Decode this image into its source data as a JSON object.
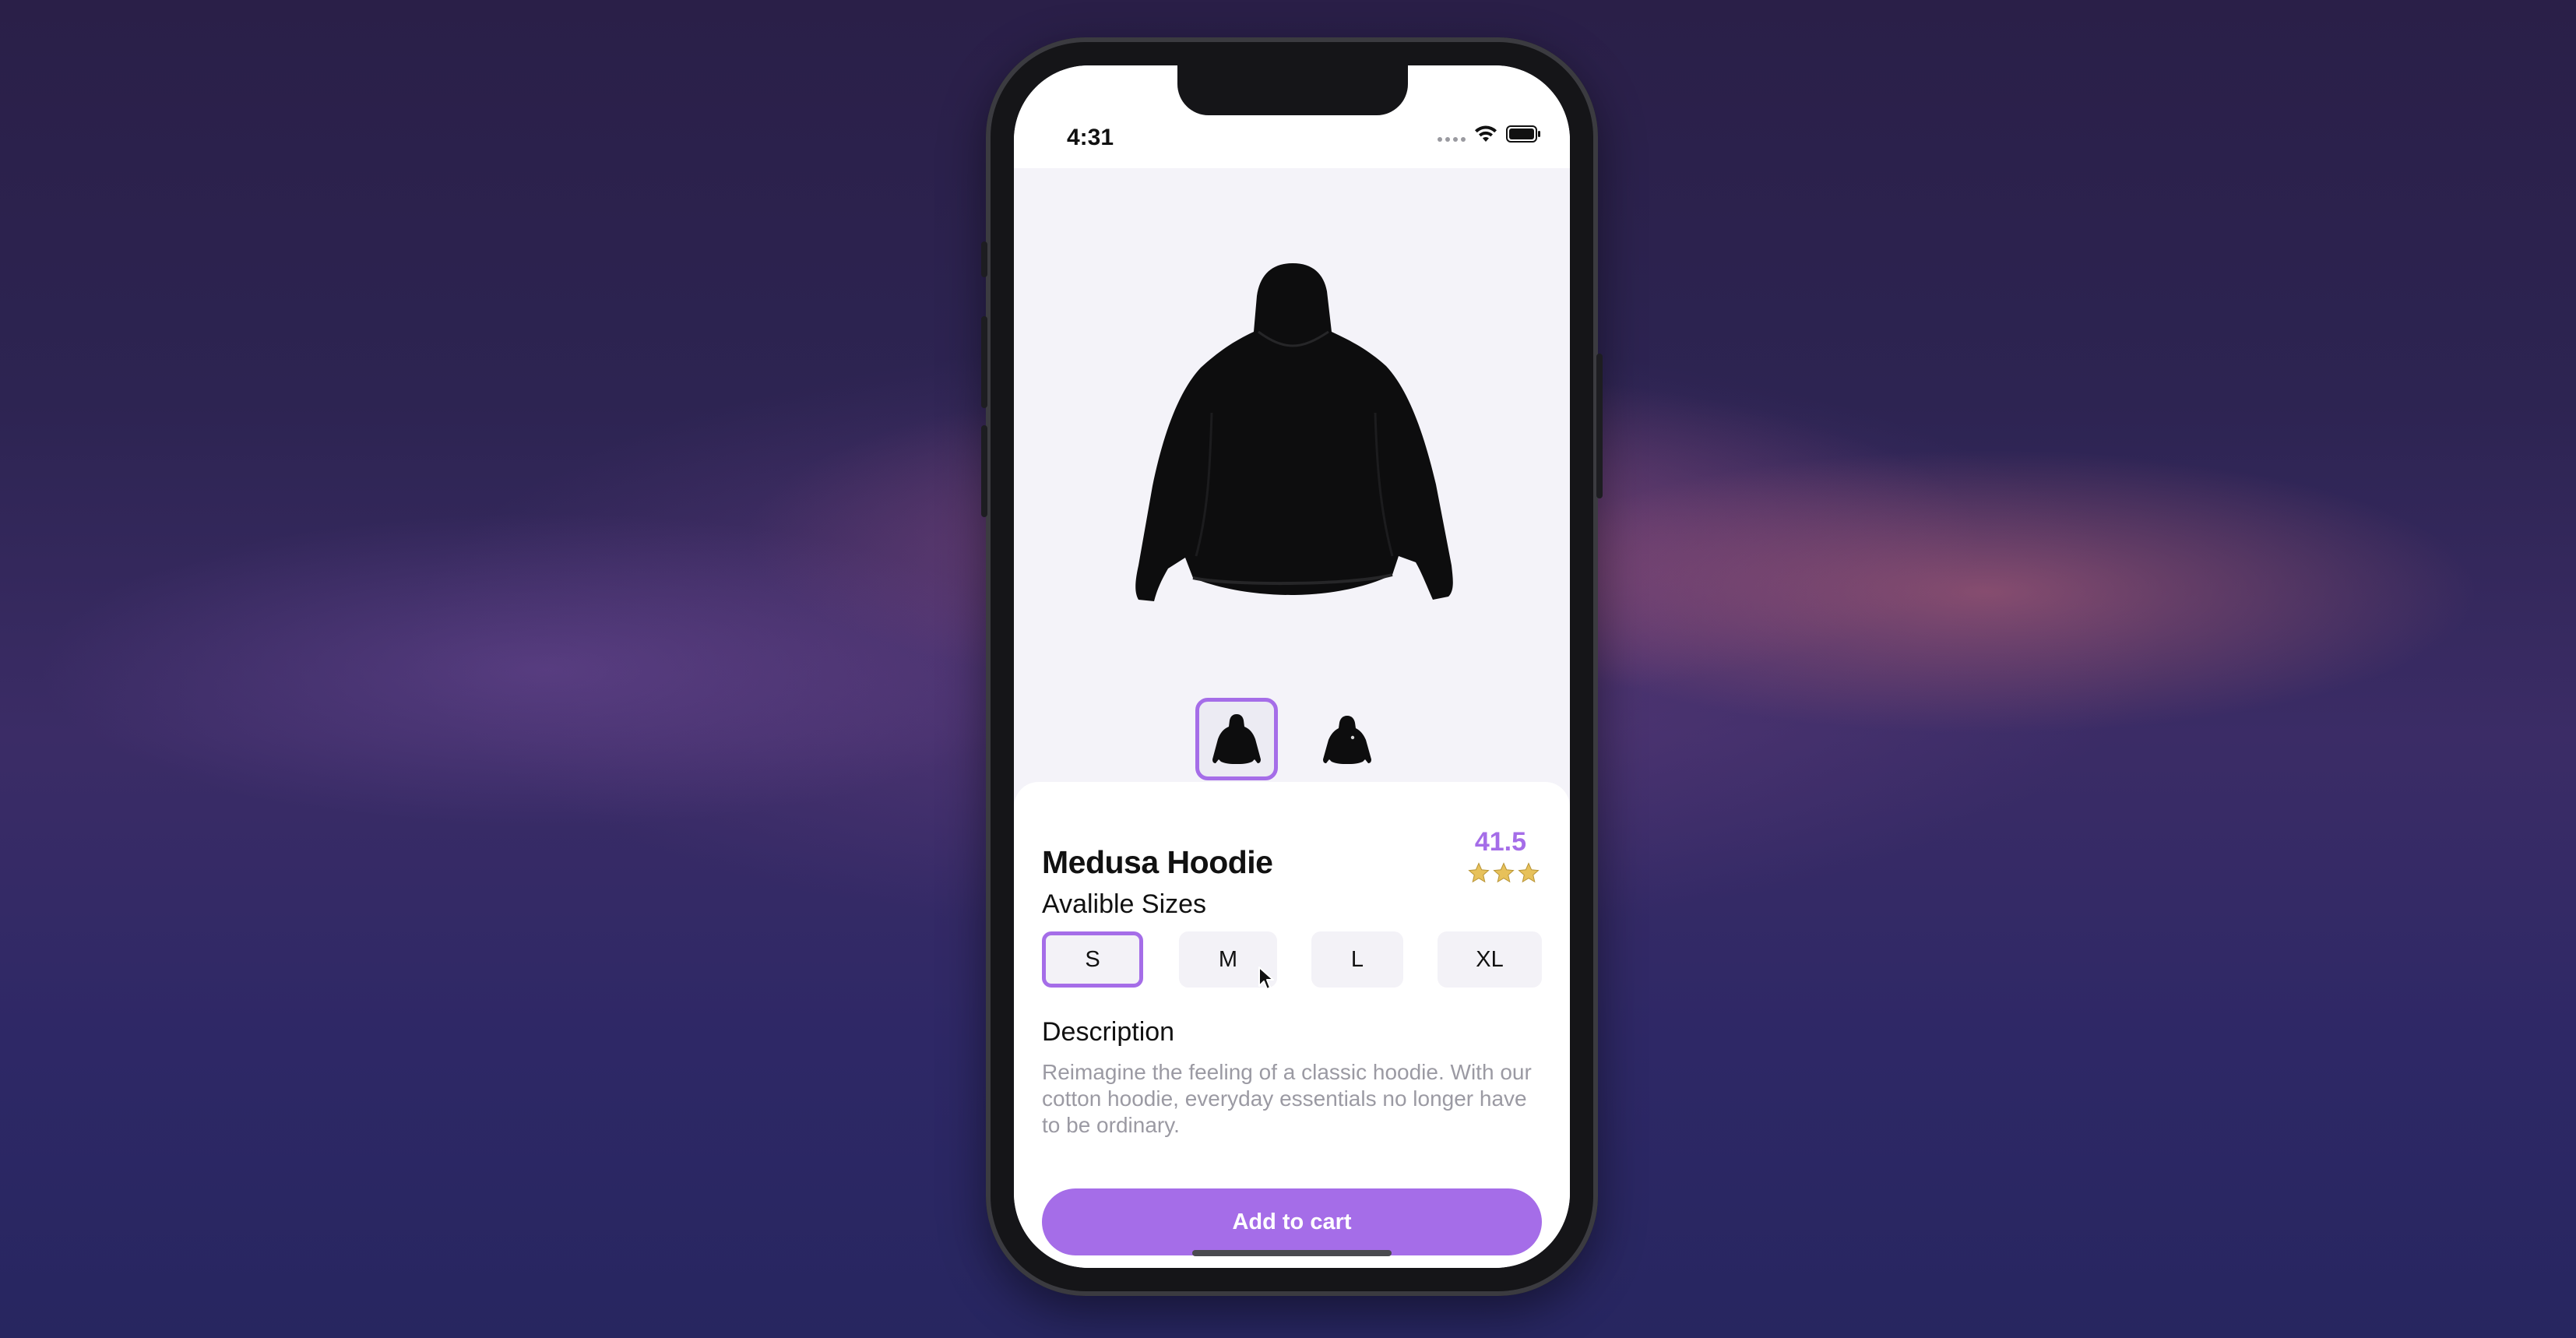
{
  "status_bar": {
    "time": "4:31"
  },
  "product": {
    "name": "Medusa Hoodie",
    "price": "41.5",
    "rating_stars": 3,
    "gallery": {
      "main_image": "black-hoodie-back-view",
      "thumbnails": [
        "black-hoodie-back-view",
        "black-hoodie-front-view"
      ],
      "selected_index": 0
    }
  },
  "sizes": {
    "label": "Avalible Sizes",
    "options": [
      "S",
      "M",
      "L",
      "XL"
    ],
    "selected": "S"
  },
  "description": {
    "label": "Description",
    "text": "Reimagine the feeling of a classic hoodie. With our cotton hoodie, everyday essentials no longer have to be ordinary."
  },
  "cta": {
    "label": "Add to cart"
  },
  "colors": {
    "accent": "#a56de8",
    "star": "#e7c15a",
    "text_primary": "#111111",
    "text_secondary": "#9b9aa3",
    "chip_bg": "#f3f2f7"
  }
}
